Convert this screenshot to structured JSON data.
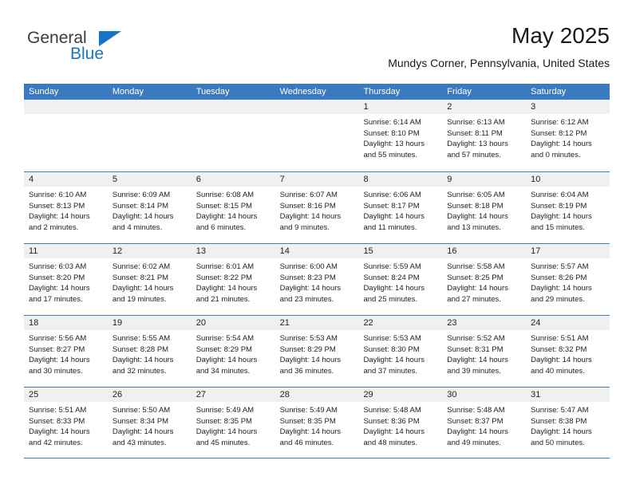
{
  "brand": {
    "name_part1": "General",
    "name_part2": "Blue",
    "triangle_icon": "triangle-icon",
    "accent_color": "#1773c4"
  },
  "header": {
    "month_title": "May 2025",
    "location": "Mundys Corner, Pennsylvania, United States"
  },
  "calendar": {
    "header_bg": "#3a7ac0",
    "day_head_bg": "#f0f0f0",
    "weekdays": [
      "Sunday",
      "Monday",
      "Tuesday",
      "Wednesday",
      "Thursday",
      "Friday",
      "Saturday"
    ],
    "weeks": [
      [
        {
          "day": "",
          "lines": []
        },
        {
          "day": "",
          "lines": []
        },
        {
          "day": "",
          "lines": []
        },
        {
          "day": "",
          "lines": []
        },
        {
          "day": "1",
          "lines": [
            "Sunrise: 6:14 AM",
            "Sunset: 8:10 PM",
            "Daylight: 13 hours",
            "and 55 minutes."
          ]
        },
        {
          "day": "2",
          "lines": [
            "Sunrise: 6:13 AM",
            "Sunset: 8:11 PM",
            "Daylight: 13 hours",
            "and 57 minutes."
          ]
        },
        {
          "day": "3",
          "lines": [
            "Sunrise: 6:12 AM",
            "Sunset: 8:12 PM",
            "Daylight: 14 hours",
            "and 0 minutes."
          ]
        }
      ],
      [
        {
          "day": "4",
          "lines": [
            "Sunrise: 6:10 AM",
            "Sunset: 8:13 PM",
            "Daylight: 14 hours",
            "and 2 minutes."
          ]
        },
        {
          "day": "5",
          "lines": [
            "Sunrise: 6:09 AM",
            "Sunset: 8:14 PM",
            "Daylight: 14 hours",
            "and 4 minutes."
          ]
        },
        {
          "day": "6",
          "lines": [
            "Sunrise: 6:08 AM",
            "Sunset: 8:15 PM",
            "Daylight: 14 hours",
            "and 6 minutes."
          ]
        },
        {
          "day": "7",
          "lines": [
            "Sunrise: 6:07 AM",
            "Sunset: 8:16 PM",
            "Daylight: 14 hours",
            "and 9 minutes."
          ]
        },
        {
          "day": "8",
          "lines": [
            "Sunrise: 6:06 AM",
            "Sunset: 8:17 PM",
            "Daylight: 14 hours",
            "and 11 minutes."
          ]
        },
        {
          "day": "9",
          "lines": [
            "Sunrise: 6:05 AM",
            "Sunset: 8:18 PM",
            "Daylight: 14 hours",
            "and 13 minutes."
          ]
        },
        {
          "day": "10",
          "lines": [
            "Sunrise: 6:04 AM",
            "Sunset: 8:19 PM",
            "Daylight: 14 hours",
            "and 15 minutes."
          ]
        }
      ],
      [
        {
          "day": "11",
          "lines": [
            "Sunrise: 6:03 AM",
            "Sunset: 8:20 PM",
            "Daylight: 14 hours",
            "and 17 minutes."
          ]
        },
        {
          "day": "12",
          "lines": [
            "Sunrise: 6:02 AM",
            "Sunset: 8:21 PM",
            "Daylight: 14 hours",
            "and 19 minutes."
          ]
        },
        {
          "day": "13",
          "lines": [
            "Sunrise: 6:01 AM",
            "Sunset: 8:22 PM",
            "Daylight: 14 hours",
            "and 21 minutes."
          ]
        },
        {
          "day": "14",
          "lines": [
            "Sunrise: 6:00 AM",
            "Sunset: 8:23 PM",
            "Daylight: 14 hours",
            "and 23 minutes."
          ]
        },
        {
          "day": "15",
          "lines": [
            "Sunrise: 5:59 AM",
            "Sunset: 8:24 PM",
            "Daylight: 14 hours",
            "and 25 minutes."
          ]
        },
        {
          "day": "16",
          "lines": [
            "Sunrise: 5:58 AM",
            "Sunset: 8:25 PM",
            "Daylight: 14 hours",
            "and 27 minutes."
          ]
        },
        {
          "day": "17",
          "lines": [
            "Sunrise: 5:57 AM",
            "Sunset: 8:26 PM",
            "Daylight: 14 hours",
            "and 29 minutes."
          ]
        }
      ],
      [
        {
          "day": "18",
          "lines": [
            "Sunrise: 5:56 AM",
            "Sunset: 8:27 PM",
            "Daylight: 14 hours",
            "and 30 minutes."
          ]
        },
        {
          "day": "19",
          "lines": [
            "Sunrise: 5:55 AM",
            "Sunset: 8:28 PM",
            "Daylight: 14 hours",
            "and 32 minutes."
          ]
        },
        {
          "day": "20",
          "lines": [
            "Sunrise: 5:54 AM",
            "Sunset: 8:29 PM",
            "Daylight: 14 hours",
            "and 34 minutes."
          ]
        },
        {
          "day": "21",
          "lines": [
            "Sunrise: 5:53 AM",
            "Sunset: 8:29 PM",
            "Daylight: 14 hours",
            "and 36 minutes."
          ]
        },
        {
          "day": "22",
          "lines": [
            "Sunrise: 5:53 AM",
            "Sunset: 8:30 PM",
            "Daylight: 14 hours",
            "and 37 minutes."
          ]
        },
        {
          "day": "23",
          "lines": [
            "Sunrise: 5:52 AM",
            "Sunset: 8:31 PM",
            "Daylight: 14 hours",
            "and 39 minutes."
          ]
        },
        {
          "day": "24",
          "lines": [
            "Sunrise: 5:51 AM",
            "Sunset: 8:32 PM",
            "Daylight: 14 hours",
            "and 40 minutes."
          ]
        }
      ],
      [
        {
          "day": "25",
          "lines": [
            "Sunrise: 5:51 AM",
            "Sunset: 8:33 PM",
            "Daylight: 14 hours",
            "and 42 minutes."
          ]
        },
        {
          "day": "26",
          "lines": [
            "Sunrise: 5:50 AM",
            "Sunset: 8:34 PM",
            "Daylight: 14 hours",
            "and 43 minutes."
          ]
        },
        {
          "day": "27",
          "lines": [
            "Sunrise: 5:49 AM",
            "Sunset: 8:35 PM",
            "Daylight: 14 hours",
            "and 45 minutes."
          ]
        },
        {
          "day": "28",
          "lines": [
            "Sunrise: 5:49 AM",
            "Sunset: 8:35 PM",
            "Daylight: 14 hours",
            "and 46 minutes."
          ]
        },
        {
          "day": "29",
          "lines": [
            "Sunrise: 5:48 AM",
            "Sunset: 8:36 PM",
            "Daylight: 14 hours",
            "and 48 minutes."
          ]
        },
        {
          "day": "30",
          "lines": [
            "Sunrise: 5:48 AM",
            "Sunset: 8:37 PM",
            "Daylight: 14 hours",
            "and 49 minutes."
          ]
        },
        {
          "day": "31",
          "lines": [
            "Sunrise: 5:47 AM",
            "Sunset: 8:38 PM",
            "Daylight: 14 hours",
            "and 50 minutes."
          ]
        }
      ]
    ]
  }
}
